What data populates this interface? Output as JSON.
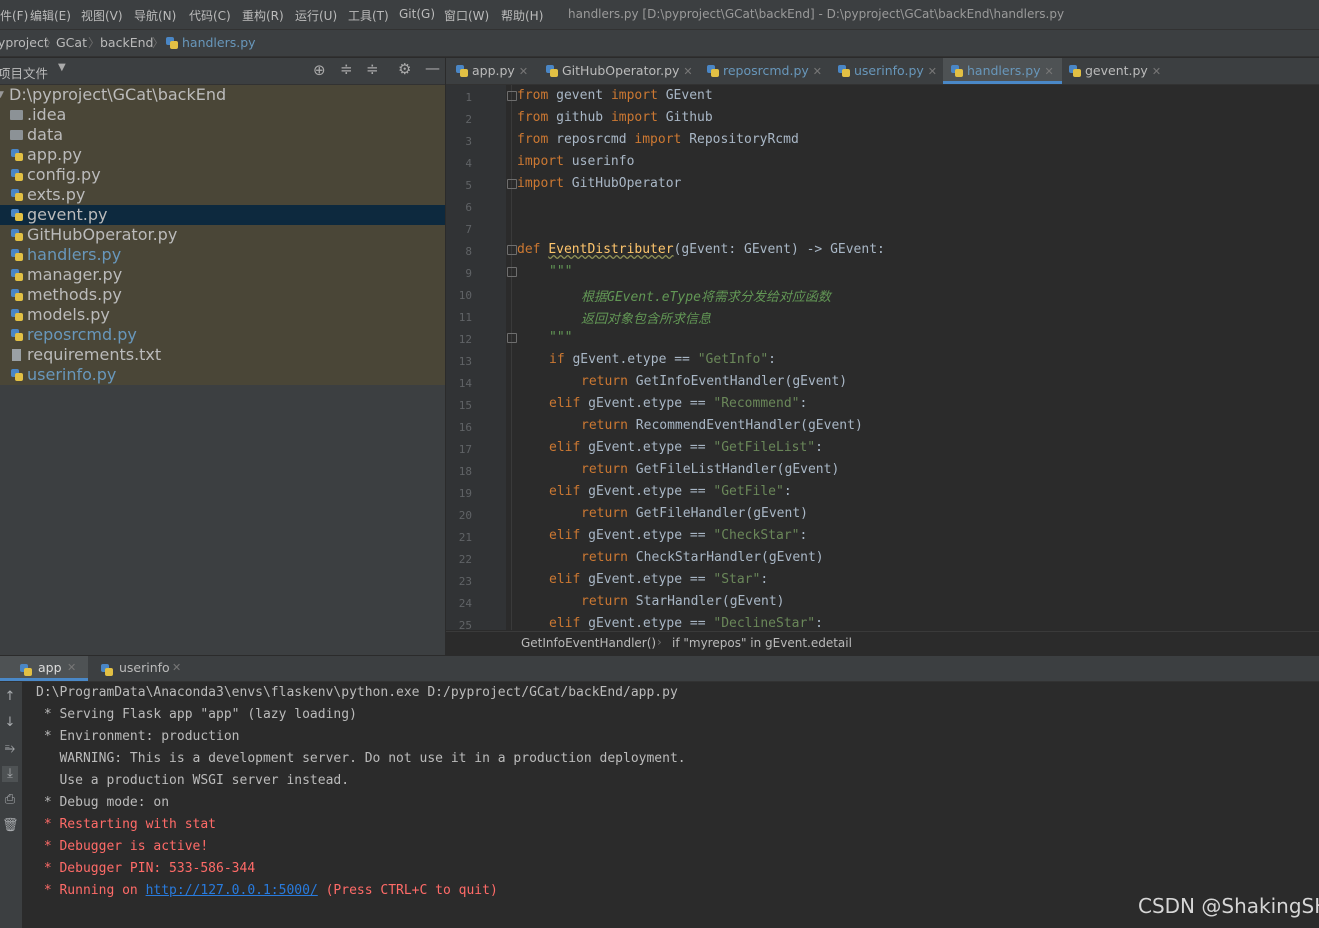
{
  "menu": [
    "文件(F)",
    "编辑(E)",
    "视图(V)",
    "导航(N)",
    "代码(C)",
    "重构(R)",
    "运行(U)",
    "工具(T)",
    "Git(G)",
    "窗口(W)",
    "帮助(H)"
  ],
  "window_title": "handlers.py [D:\\pyproject\\GCat\\backEnd] - D:\\pyproject\\GCat\\backEnd\\handlers.py",
  "breadcrumb": [
    "pyproject",
    "GCat",
    "backEnd",
    "handlers.py"
  ],
  "project_panel": {
    "title": "项目文件",
    "root": "D:\\pyproject\\GCat\\backEnd",
    "items": [
      {
        "label": ".idea",
        "type": "folder"
      },
      {
        "label": "data",
        "type": "folder"
      },
      {
        "label": "app.py",
        "type": "py"
      },
      {
        "label": "config.py",
        "type": "py"
      },
      {
        "label": "exts.py",
        "type": "py"
      },
      {
        "label": "gevent.py",
        "type": "py",
        "selected": true
      },
      {
        "label": "GitHubOperator.py",
        "type": "py"
      },
      {
        "label": "handlers.py",
        "type": "py",
        "modified": true
      },
      {
        "label": "manager.py",
        "type": "py"
      },
      {
        "label": "methods.py",
        "type": "py"
      },
      {
        "label": "models.py",
        "type": "py"
      },
      {
        "label": "reposrcmd.py",
        "type": "py",
        "modified": true
      },
      {
        "label": "requirements.txt",
        "type": "txt"
      },
      {
        "label": "userinfo.py",
        "type": "py",
        "modified": true
      }
    ]
  },
  "editor_tabs": [
    {
      "label": "app.py",
      "modified": false
    },
    {
      "label": "GitHubOperator.py",
      "modified": false
    },
    {
      "label": "reposrcmd.py",
      "modified": true
    },
    {
      "label": "userinfo.py",
      "modified": true
    },
    {
      "label": "handlers.py",
      "modified": true,
      "active": true
    },
    {
      "label": "gevent.py",
      "modified": false
    }
  ],
  "code": {
    "l1": [
      "from",
      " gevent ",
      "import",
      " GEvent"
    ],
    "l2": [
      "from",
      " github ",
      "import",
      " Github"
    ],
    "l3": [
      "from",
      " reposrcmd ",
      "import",
      " RepositoryRcmd"
    ],
    "l4": [
      "import",
      " userinfo"
    ],
    "l5": [
      "import",
      " GitHubOperator"
    ],
    "l8": [
      "def",
      " ",
      "EventDistributer",
      "(gEvent: GEvent) -> GEvent:"
    ],
    "l9": "\"\"\"",
    "l10": "根据GEvent.eType将需求分发给对应函数",
    "l11": "返回对象包含所求信息",
    "l12": "\"\"\"",
    "l13": [
      "if",
      " gEvent.etype == ",
      "\"GetInfo\"",
      ":"
    ],
    "l14": [
      "return",
      " GetInfoEventHandler(gEvent)"
    ],
    "l15": [
      "elif",
      " gEvent.etype == ",
      "\"Recommend\"",
      ":"
    ],
    "l16": [
      "return",
      " RecommendEventHandler(gEvent)"
    ],
    "l17": [
      "elif",
      " gEvent.etype == ",
      "\"GetFileList\"",
      ":"
    ],
    "l18": [
      "return",
      " GetFileListHandler(gEvent)"
    ],
    "l19": [
      "elif",
      " gEvent.etype == ",
      "\"GetFile\"",
      ":"
    ],
    "l20": [
      "return",
      " GetFileHandler(gEvent)"
    ],
    "l21": [
      "elif",
      " gEvent.etype == ",
      "\"CheckStar\"",
      ":"
    ],
    "l22": [
      "return",
      " CheckStarHandler(gEvent)"
    ],
    "l23": [
      "elif",
      " gEvent.etype == ",
      "\"Star\"",
      ":"
    ],
    "l24": [
      "return",
      " StarHandler(gEvent)"
    ],
    "l25": [
      "elif",
      " gEvent.etype == ",
      "\"DeclineStar\"",
      ":"
    ]
  },
  "line_numbers": [
    "1",
    "2",
    "3",
    "4",
    "5",
    "6",
    "7",
    "8",
    "9",
    "10",
    "11",
    "12",
    "13",
    "14",
    "15",
    "16",
    "17",
    "18",
    "19",
    "20",
    "21",
    "22",
    "23",
    "24",
    "25"
  ],
  "editor_breadcrumb": [
    "GetInfoEventHandler()",
    "if \"myrepos\" in gEvent.edetail"
  ],
  "run_tabs": [
    "app",
    "userinfo"
  ],
  "console": {
    "c1": "D:\\ProgramData\\Anaconda3\\envs\\flaskenv\\python.exe D:/pyproject/GCat/backEnd/app.py",
    "c2": " * Serving Flask app \"app\" (lazy loading)",
    "c3": " * Environment: production",
    "c4": "   WARNING: This is a development server. Do not use it in a production deployment.",
    "c5": "   Use a production WSGI server instead.",
    "c6": " * Debug mode: on",
    "c7": " * Restarting with stat",
    "c8": " * Debugger is active!",
    "c9": " * Debugger PIN: 533-586-344",
    "c10_pre": " * Running on ",
    "c10_link": "http://127.0.0.1:5000/",
    "c10_post": " (Press CTRL+C to quit)"
  },
  "watermark": "CSDN @ShakingSH"
}
